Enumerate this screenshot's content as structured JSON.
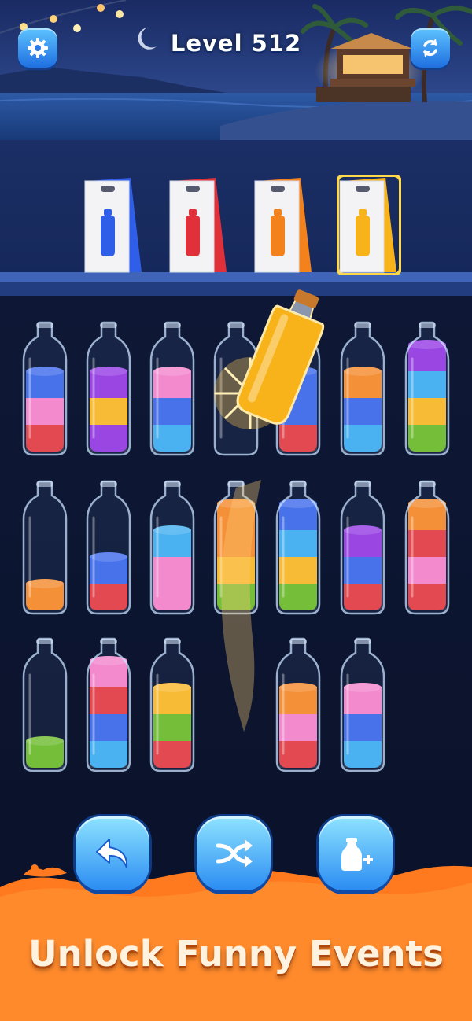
{
  "header": {
    "level_label": "Level 512",
    "settings_icon": "gear-icon",
    "restart_icon": "refresh-icon"
  },
  "colors": {
    "blue": "#2f5fe8",
    "red": "#e0303a",
    "orange": "#f3811c",
    "yellow": "#f8b21a",
    "pink": "#f27ac8",
    "purple": "#8b2de0",
    "cyan": "#33a8ef",
    "green": "#62b51e",
    "banner": "#ff7a1e"
  },
  "bags": [
    {
      "color": "blue"
    },
    {
      "color": "red"
    },
    {
      "color": "orange"
    },
    {
      "color": "yellow",
      "highlighted": true
    }
  ],
  "tubes": [
    {
      "layers": [
        "red",
        "pink",
        "blue"
      ]
    },
    {
      "layers": [
        "purple",
        "yellow",
        "purple"
      ]
    },
    {
      "layers": [
        "cyan",
        "blue",
        "pink"
      ]
    },
    {
      "layers": [],
      "lifted": true
    },
    {
      "layers": [
        "red",
        "blue",
        "blue"
      ]
    },
    {
      "layers": [
        "cyan",
        "blue",
        "orange"
      ]
    },
    {
      "layers": [
        "green",
        "yellow",
        "cyan",
        "purple"
      ]
    },
    {
      "layers": [
        "orange"
      ]
    },
    {
      "layers": [
        "red",
        "blue"
      ]
    },
    {
      "layers": [
        "pink",
        "pink",
        "cyan"
      ]
    },
    {
      "layers": [
        "green",
        "yellow",
        "orange",
        "orange"
      ]
    },
    {
      "layers": [
        "green",
        "yellow",
        "cyan",
        "blue"
      ]
    },
    {
      "layers": [
        "red",
        "blue",
        "purple"
      ]
    },
    {
      "layers": [
        "red",
        "pink",
        "red",
        "orange"
      ]
    },
    {
      "layers": [
        "green"
      ]
    },
    {
      "layers": [
        "cyan",
        "blue",
        "red",
        "pink"
      ]
    },
    {
      "layers": [
        "red",
        "green",
        "yellow"
      ]
    },
    {
      "layers": [
        "red",
        "pink",
        "orange"
      ]
    },
    {
      "layers": [
        "cyan",
        "blue",
        "pink"
      ]
    }
  ],
  "pouring_bottle": {
    "color": "yellow"
  },
  "actions": [
    {
      "label": "undo",
      "icon": "undo-icon"
    },
    {
      "label": "shuffle",
      "icon": "shuffle-icon"
    },
    {
      "label": "add bottle",
      "icon": "add-bottle-icon"
    }
  ],
  "banner": {
    "text": "Unlock Funny Events"
  }
}
